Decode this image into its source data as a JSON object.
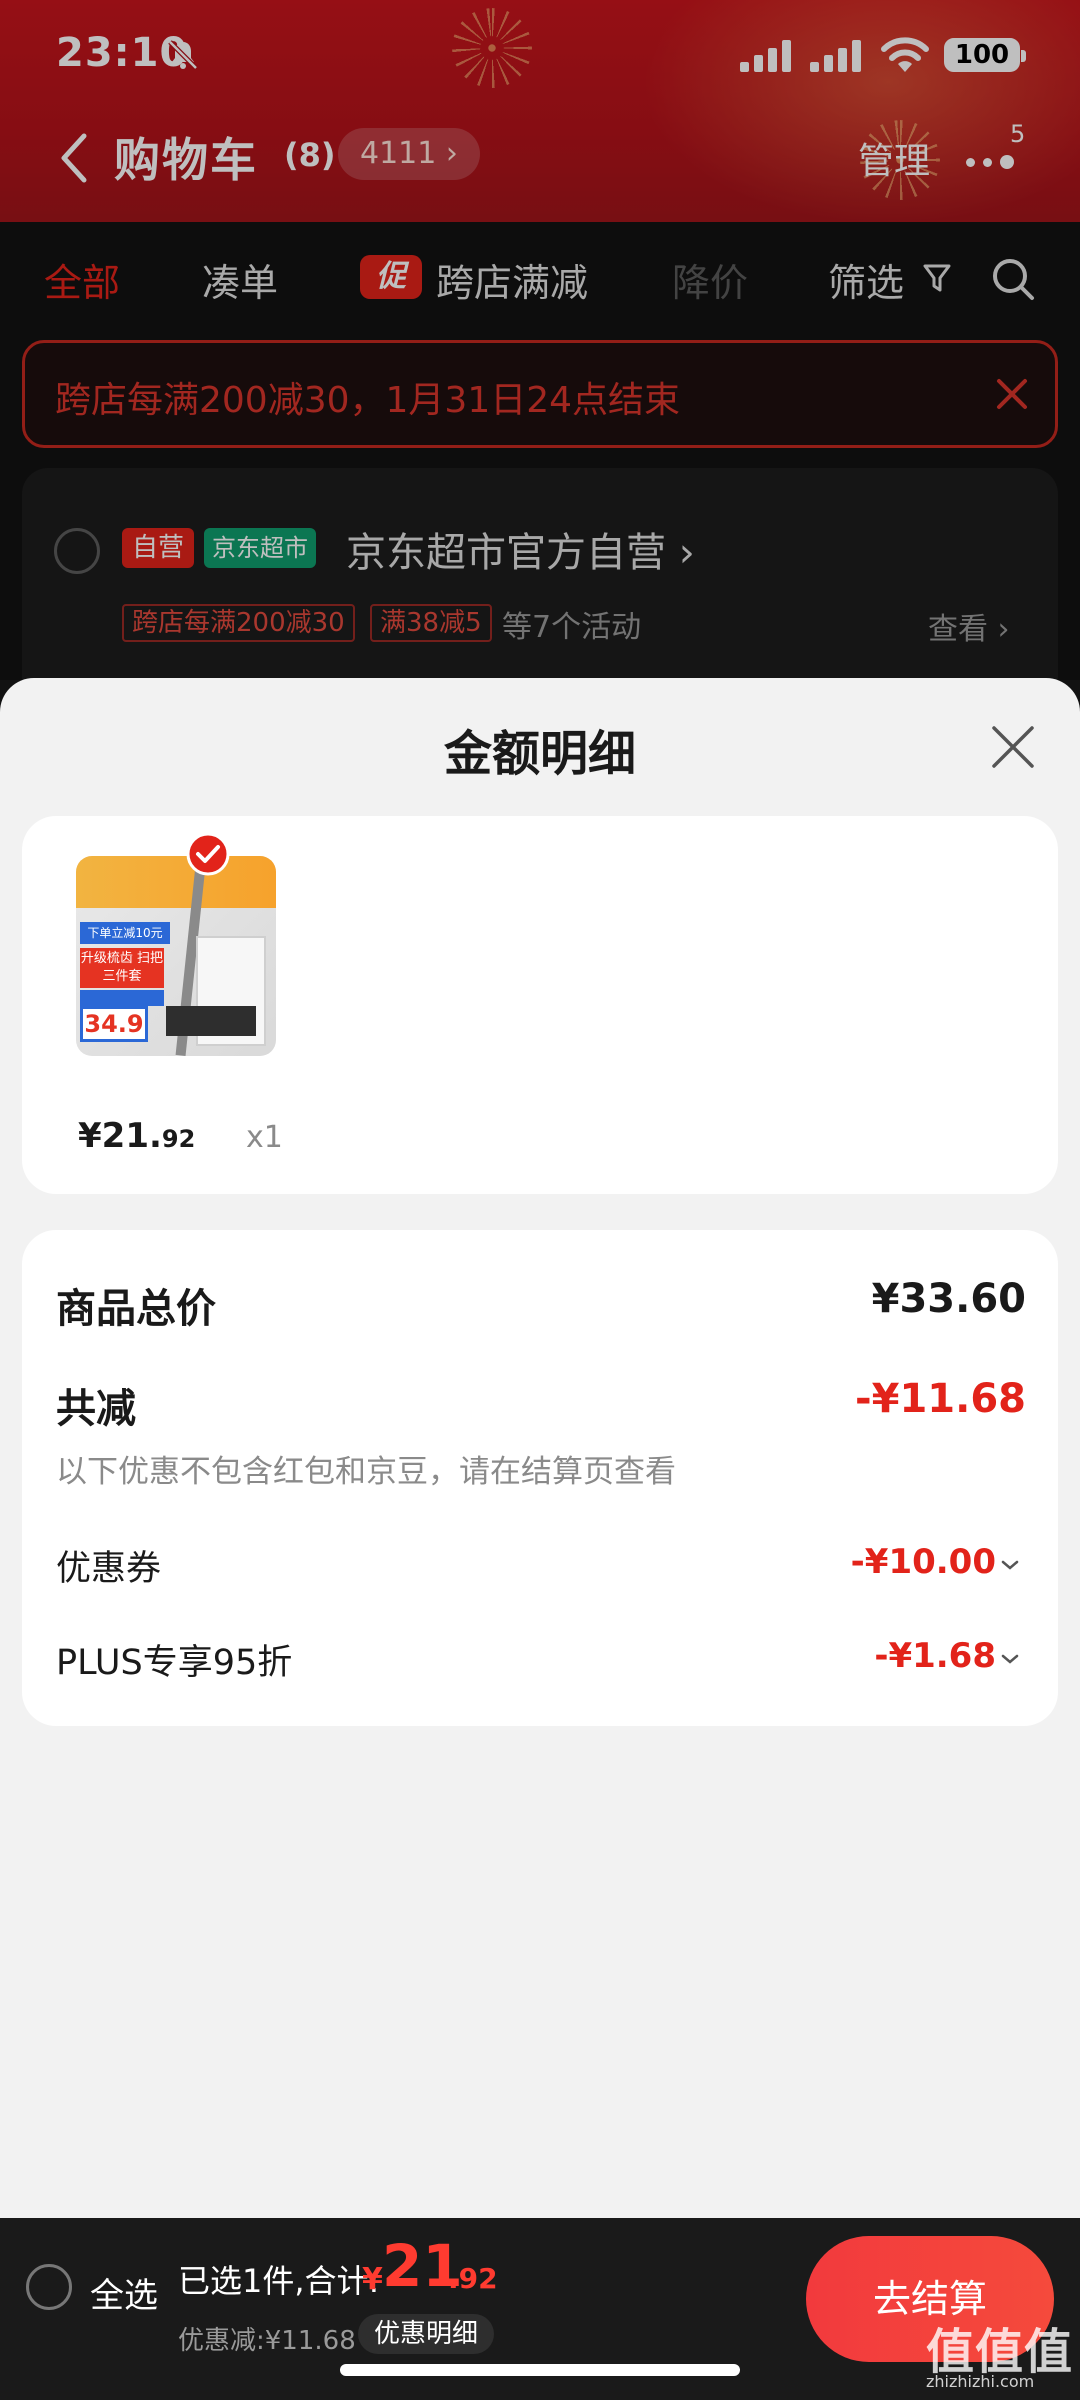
{
  "status_bar": {
    "time": "23:10",
    "battery": "100"
  },
  "nav": {
    "title": "购物车",
    "count": "(8)",
    "pill": "4111 ›",
    "manage": "管理",
    "more_badge": "5"
  },
  "tabs": {
    "all": "全部",
    "bundle": "凑单",
    "promo_tag": "促",
    "cross_store": "跨店满减",
    "price_drop": "降价",
    "filter": "筛选"
  },
  "banner": {
    "text": "跨店每满200减30，1月31日24点结束"
  },
  "store": {
    "tag_self": "自营",
    "tag_market": "京东超市",
    "name": "京东超市官方自营 ›",
    "chip1": "跨店每满200减30",
    "chip2": "满38减5",
    "more": "等7个活动",
    "view": "查看 ›"
  },
  "sheet": {
    "title": "金额明细",
    "item": {
      "price_int": "¥21.",
      "price_dec": "92",
      "qty": "x1",
      "image_text": {
        "head": "下单立减10元",
        "red": "升级梳齿 扫把三件套",
        "price": "34.9"
      }
    },
    "summary": {
      "total_label": "商品总价",
      "total_value": "¥33.60",
      "reduce_label": "共减",
      "reduce_value": "-¥11.68",
      "note": "以下优惠不包含红包和京豆，请在结算页查看",
      "coupon_label": "优惠券",
      "coupon_value": "-¥10.00",
      "plus_label": "PLUS专享95折",
      "plus_value": "-¥1.68"
    }
  },
  "bottom_bar": {
    "select_all": "全选",
    "selected": "已选1件,合计:",
    "currency": "¥",
    "total_int": "21",
    "total_dec": ".92",
    "discount": "优惠减:¥11.68",
    "detail": "优惠明细",
    "checkout": "去结算"
  },
  "watermark": {
    "main": "值值值",
    "sub": "zhizhizhi.com"
  },
  "colors": {
    "accent": "#e2231a",
    "header": "#c8151c",
    "checkout": "#f23a3d"
  }
}
